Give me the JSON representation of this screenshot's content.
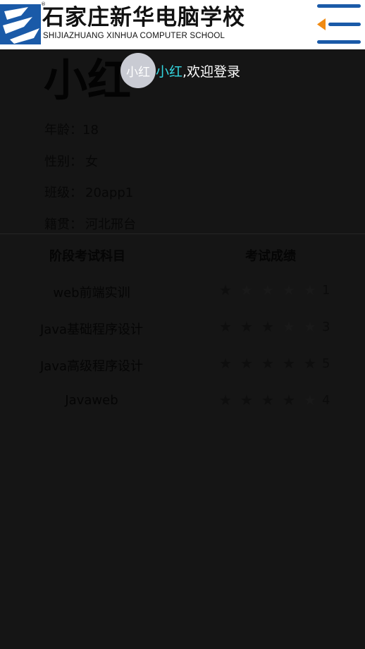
{
  "header": {
    "logo_cn": "石家庄新华电脑学校",
    "logo_en": "SHIJIAZHUANG XINHUA COMPUTER SCHOOL",
    "logo_reg": "®",
    "colors": {
      "logo_blue": "#1a5aa8",
      "menu_blue": "#1a5aa8",
      "menu_accent": "#f08a12"
    }
  },
  "welcome": {
    "avatar_text": "小红",
    "name": "小红",
    "message": ",欢迎登录"
  },
  "profile": {
    "name": "小红",
    "age_label": "年龄：",
    "age": "18",
    "gender_label": "性别：",
    "gender": "女",
    "class_label": "班级：",
    "class": "20app1",
    "hometown_label": "籍贯：",
    "hometown": "河北邢台"
  },
  "grades": {
    "col_subject": "阶段考试科目",
    "col_score": "考试成绩",
    "max_stars": 5,
    "rows": [
      {
        "subject": "web前端实训",
        "score": 1
      },
      {
        "subject": "Java基础程序设计",
        "score": 3
      },
      {
        "subject": "Java高级程序设计",
        "score": 5
      },
      {
        "subject": "Javaweb",
        "score": 4
      }
    ]
  }
}
